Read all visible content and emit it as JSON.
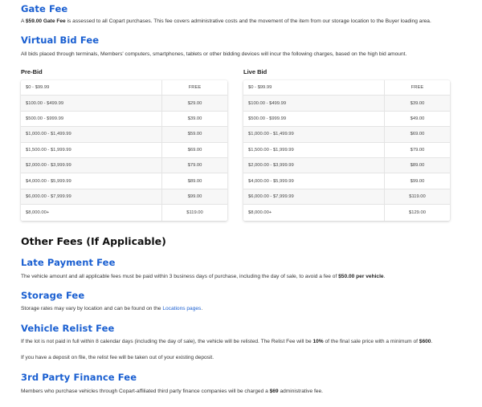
{
  "gate_fee": {
    "title": "Gate Fee",
    "amount": "$59.00 Gate Fee",
    "prefix": "A ",
    "text": " is assessed to all Copart purchases. This fee covers administrative costs and the movement of the item from our storage location to the Buyer loading area."
  },
  "virtual_bid_fee": {
    "title": "Virtual Bid Fee",
    "text": "All bids placed through terminals, Members' computers, smartphones, tablets or other bidding devices will incur the following charges, based on the high bid amount."
  },
  "pre_bid": {
    "title": "Pre-Bid",
    "rows": [
      {
        "range": "$0 - $99.99",
        "fee": "FREE"
      },
      {
        "range": "$100.00 - $499.99",
        "fee": "$29.00"
      },
      {
        "range": "$500.00 - $999.99",
        "fee": "$39.00"
      },
      {
        "range": "$1,000.00 - $1,499.99",
        "fee": "$59.00"
      },
      {
        "range": "$1,500.00 - $1,999.99",
        "fee": "$69.00"
      },
      {
        "range": "$2,000.00 - $3,999.99",
        "fee": "$79.00"
      },
      {
        "range": "$4,000.00 - $5,999.99",
        "fee": "$89.00"
      },
      {
        "range": "$6,000.00 - $7,999.99",
        "fee": "$99.00"
      },
      {
        "range": "$8,000.00+",
        "fee": "$119.00"
      }
    ]
  },
  "live_bid": {
    "title": "Live Bid",
    "rows": [
      {
        "range": "$0 - $99.99",
        "fee": "FREE"
      },
      {
        "range": "$100.00 - $499.99",
        "fee": "$39.00"
      },
      {
        "range": "$500.00 - $999.99",
        "fee": "$49.00"
      },
      {
        "range": "$1,000.00 - $1,499.99",
        "fee": "$69.00"
      },
      {
        "range": "$1,500.00 - $1,999.99",
        "fee": "$79.00"
      },
      {
        "range": "$2,000.00 - $3,999.99",
        "fee": "$89.00"
      },
      {
        "range": "$4,000.00 - $5,999.99",
        "fee": "$99.00"
      },
      {
        "range": "$6,000.00 - $7,999.99",
        "fee": "$119.00"
      },
      {
        "range": "$8,000.00+",
        "fee": "$129.00"
      }
    ]
  },
  "other_fees": {
    "title": "Other Fees (If Applicable)"
  },
  "late_payment": {
    "title": "Late Payment Fee",
    "text": "The vehicle amount and all applicable fees must be paid within 3 business days of purchase, including the day of sale, to avoid a fee of ",
    "amount": "$50.00 per vehicle",
    "suffix": "."
  },
  "storage_fee": {
    "title": "Storage Fee",
    "text": "Storage rates may vary by location and can be found on the ",
    "link": "Locations pages",
    "suffix": "."
  },
  "relist_fee": {
    "title": "Vehicle Relist Fee",
    "text1": "If the lot is not paid in full within 8 calendar days (including the day of sale), the vehicle will be relisted. The Relist Fee will be ",
    "percent": "10%",
    "text2": " of the final sale price with a minimum of ",
    "minimum": "$600",
    "suffix": ".",
    "deposit_text": "If you have a deposit on file, the relist fee will be taken out of your existing deposit."
  },
  "third_party": {
    "title": "3rd Party Finance Fee",
    "text": "Members who purchase vehicles through Copart-affiliated third party finance companies will be charged a ",
    "amount": "$69",
    "suffix": " administrative fee."
  }
}
